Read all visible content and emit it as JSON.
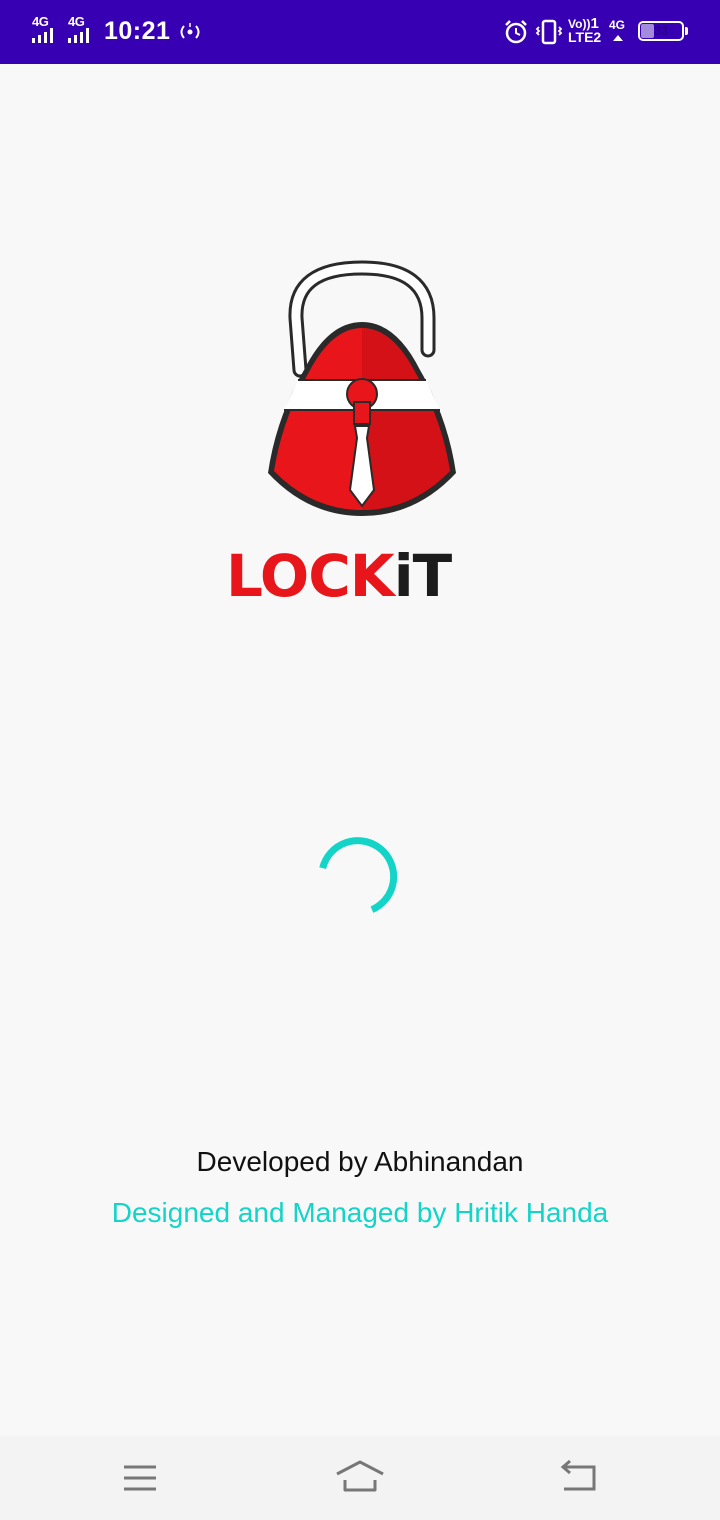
{
  "status_bar": {
    "sim1_network": "4G",
    "sim2_network": "4G",
    "time": "10:21",
    "volte_label_top": "Vo))",
    "volte_label_bottom": "LTE2",
    "volte_sim": "1",
    "data_network": "4G",
    "battery_level": "33",
    "battery_fraction": 0.33,
    "icons": [
      "signal-icon",
      "signal-icon",
      "hotspot-icon",
      "alarm-icon",
      "vibrate-icon",
      "battery-icon"
    ]
  },
  "logo": {
    "wordmark_part1": "LOCK",
    "wordmark_part2": "iT",
    "colors": {
      "red": "#e8161b",
      "dark": "#1c1c1c"
    }
  },
  "loader": {
    "color": "#14d4c8"
  },
  "credits": {
    "developer": "Developed by Abhinandan",
    "designer": "Designed and Managed by Hritik Handa"
  },
  "nav_bar": {
    "buttons": [
      "menu-icon",
      "home-icon",
      "back-icon"
    ]
  },
  "colors": {
    "status_bar_bg": "#3700b3",
    "background": "#f8f8f8",
    "accent": "#14d4c8"
  }
}
